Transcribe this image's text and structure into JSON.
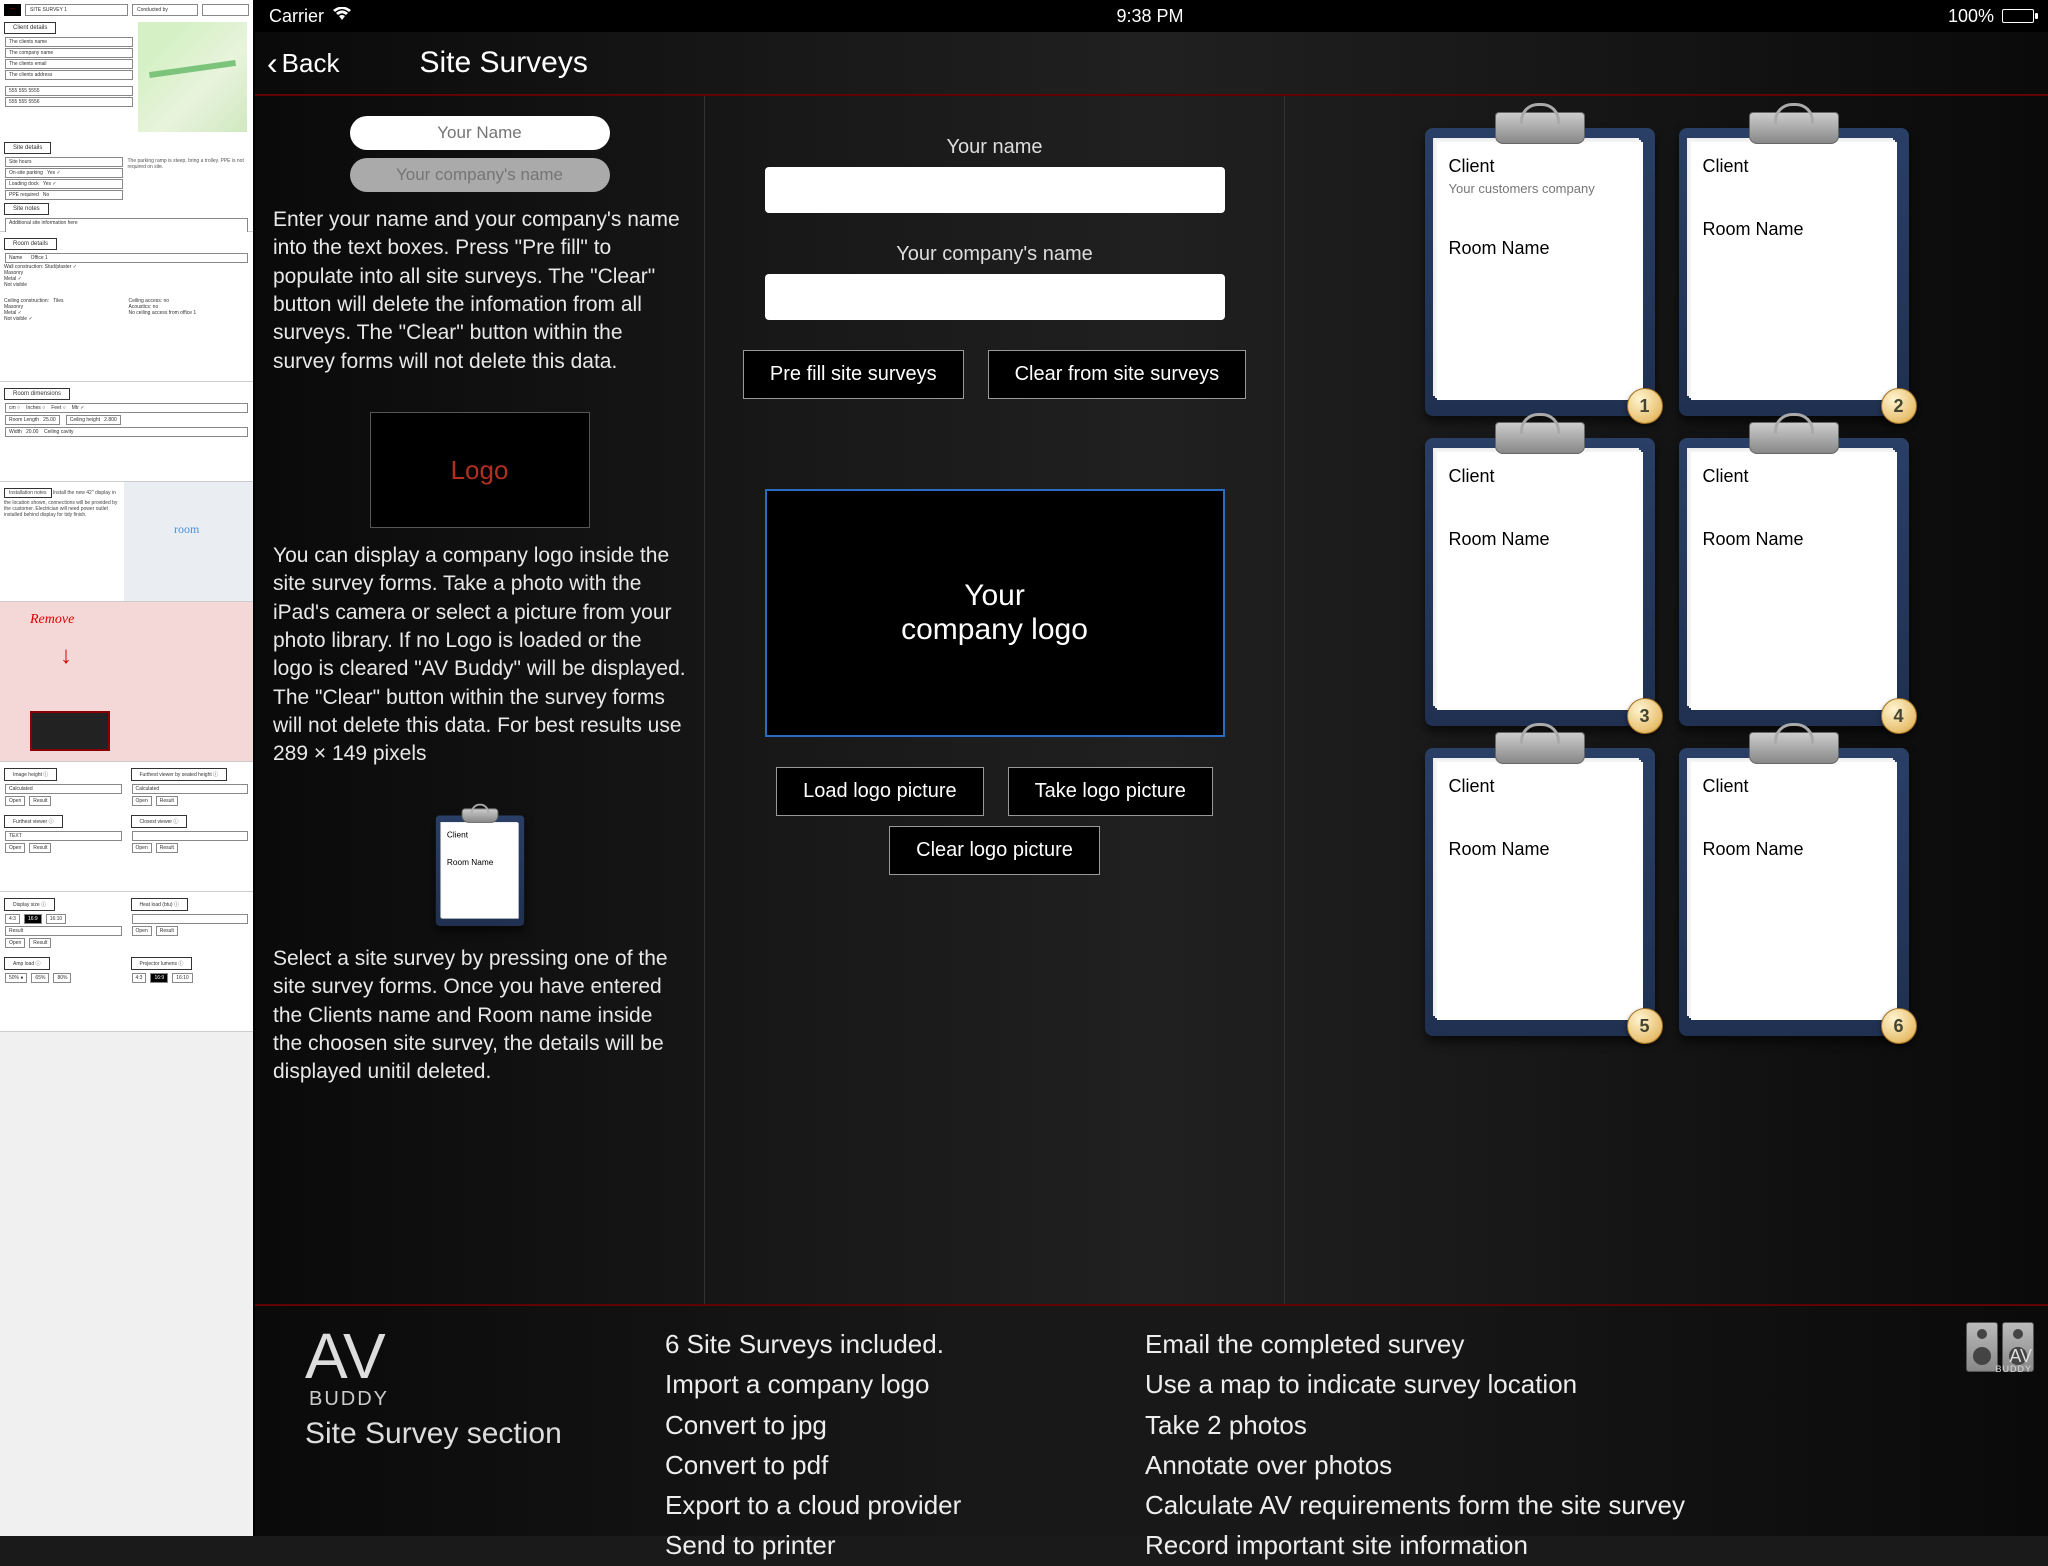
{
  "statusbar": {
    "carrier": "Carrier",
    "time": "9:38 PM",
    "battery": "100%"
  },
  "nav": {
    "back": "Back",
    "title": "Site Surveys"
  },
  "instructions": {
    "name_placeholder": "Your Name",
    "company_placeholder": "Your company's name",
    "section1": "Enter your name and your company's name into the text boxes. Press \"Pre fill\" to populate into all site surveys. The \"Clear\" button will delete the infomation from all surveys. The \"Clear\" button within the survey forms will not delete this data.",
    "logo_label": "Logo",
    "section2": "You can display a company logo inside the site survey forms. Take a photo with the iPad's camera or select a picture from your photo library. If no Logo is loaded or the logo is cleared \"AV Buddy\" will be displayed. The \"Clear\" button within the survey forms will not delete this data. For best results use 289 × 149 pixels",
    "mini_client": "Client",
    "mini_room": "Room Name",
    "section3": "Select a site survey by pressing one of the site survey forms. Once you have entered the Clients name and Room name inside the choosen site survey, the details will be displayed unitil deleted."
  },
  "center": {
    "name_label": "Your name",
    "company_label": "Your company's name",
    "prefill_btn": "Pre fill site surveys",
    "clear_btn": "Clear from site surveys",
    "logo_line1": "Your",
    "logo_line2": "company logo",
    "load_btn": "Load logo picture",
    "take_btn": "Take logo picture",
    "clearlogo_btn": "Clear logo picture"
  },
  "surveys": [
    {
      "client": "Client",
      "company": "Your customers company",
      "room": "Room Name",
      "num": "1"
    },
    {
      "client": "Client",
      "company": "",
      "room": "Room Name",
      "num": "2"
    },
    {
      "client": "Client",
      "company": "",
      "room": "Room Name",
      "num": "3"
    },
    {
      "client": "Client",
      "company": "",
      "room": "Room Name",
      "num": "4"
    },
    {
      "client": "Client",
      "company": "",
      "room": "Room Name",
      "num": "5"
    },
    {
      "client": "Client",
      "company": "",
      "room": "Room Name",
      "num": "6"
    }
  ],
  "footer": {
    "brand_av": "AV",
    "brand_buddy": "BUDDY",
    "brand_sub": "Site Survey section",
    "col1": [
      "6 Site Surveys included.",
      "Import a company logo",
      "Convert to jpg",
      "Convert to pdf",
      "Export to a cloud provider",
      "Send to printer"
    ],
    "col2": [
      "Email the completed survey",
      "Use a map to indicate survey location",
      "Take 2 photos",
      "Annotate over photos",
      "Calculate AV requirements form the site survey",
      "Record important site information"
    ]
  },
  "thumbs": {
    "t1_title": "SITE SURVEY 1",
    "t1_tabs": [
      "Client details"
    ],
    "t2_tab": "Site details",
    "t3_tab": "Site notes",
    "t4_tab": "Room details",
    "remove_text": "Remove"
  }
}
